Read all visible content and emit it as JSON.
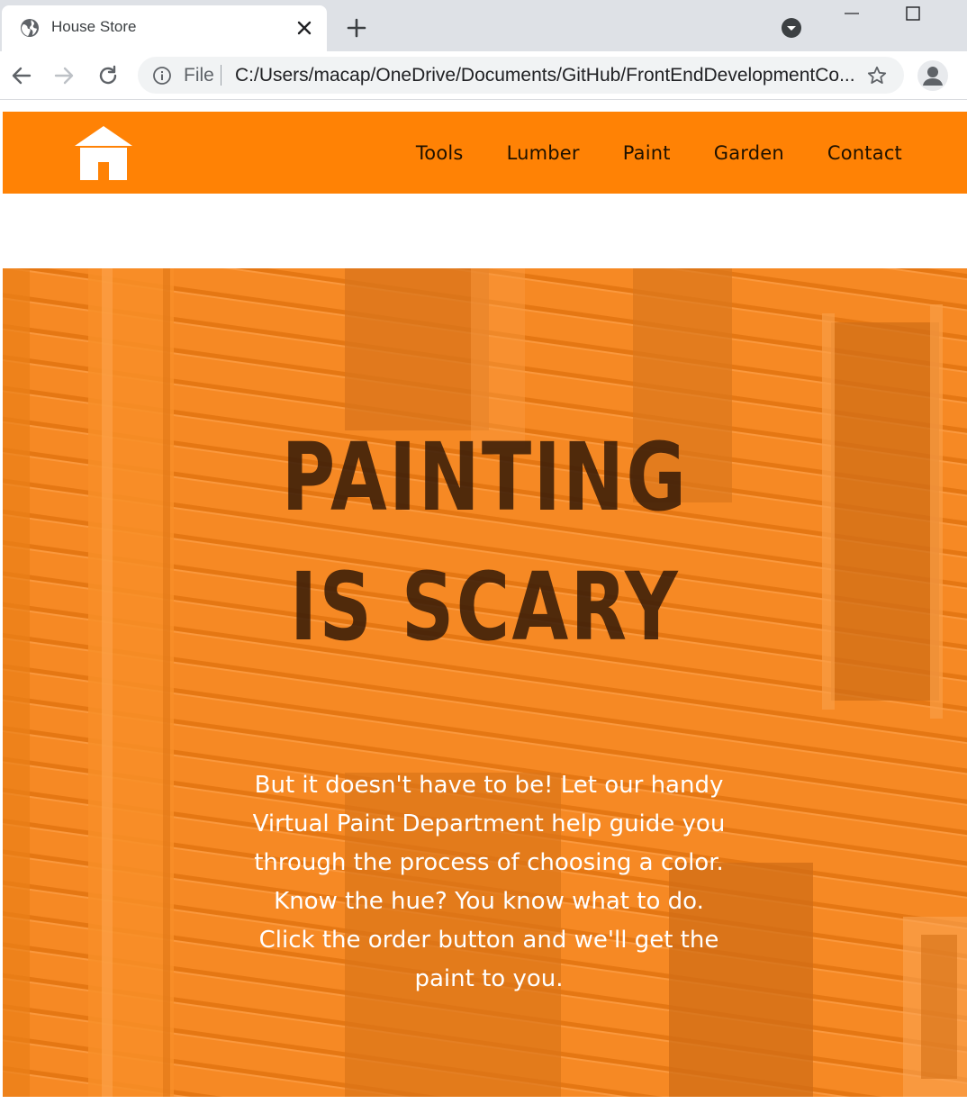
{
  "browser": {
    "tab_title": "House Store",
    "omnibox": {
      "scheme_label": "File",
      "url": "C:/Users/macap/OneDrive/Documents/GitHub/FrontEndDevelopmentCo..."
    },
    "icons": [
      "globe-icon",
      "close-icon",
      "plus-icon",
      "tab-search-icon",
      "minimize-icon",
      "maximize-icon",
      "back-arrow-icon",
      "forward-arrow-icon",
      "reload-icon",
      "info-icon",
      "star-icon",
      "profile-icon"
    ]
  },
  "site": {
    "logo_icon": "house-icon",
    "nav": [
      {
        "label": "Tools"
      },
      {
        "label": "Lumber"
      },
      {
        "label": "Paint"
      },
      {
        "label": "Garden"
      },
      {
        "label": "Contact"
      }
    ],
    "hero": {
      "title_line1": "Painting",
      "title_line2": "is scary",
      "body": "But it doesn't have to be! Let our handy Virtual Paint Department help guide you through the process of choosing a color. Know the hue? You know what to do. Click the order button and we'll get the paint to you."
    }
  },
  "colors": {
    "header_bg": "#ff8205",
    "hero_tint": "#f08420",
    "title_color": "#3a1d08",
    "nav_text": "#1e1100"
  }
}
